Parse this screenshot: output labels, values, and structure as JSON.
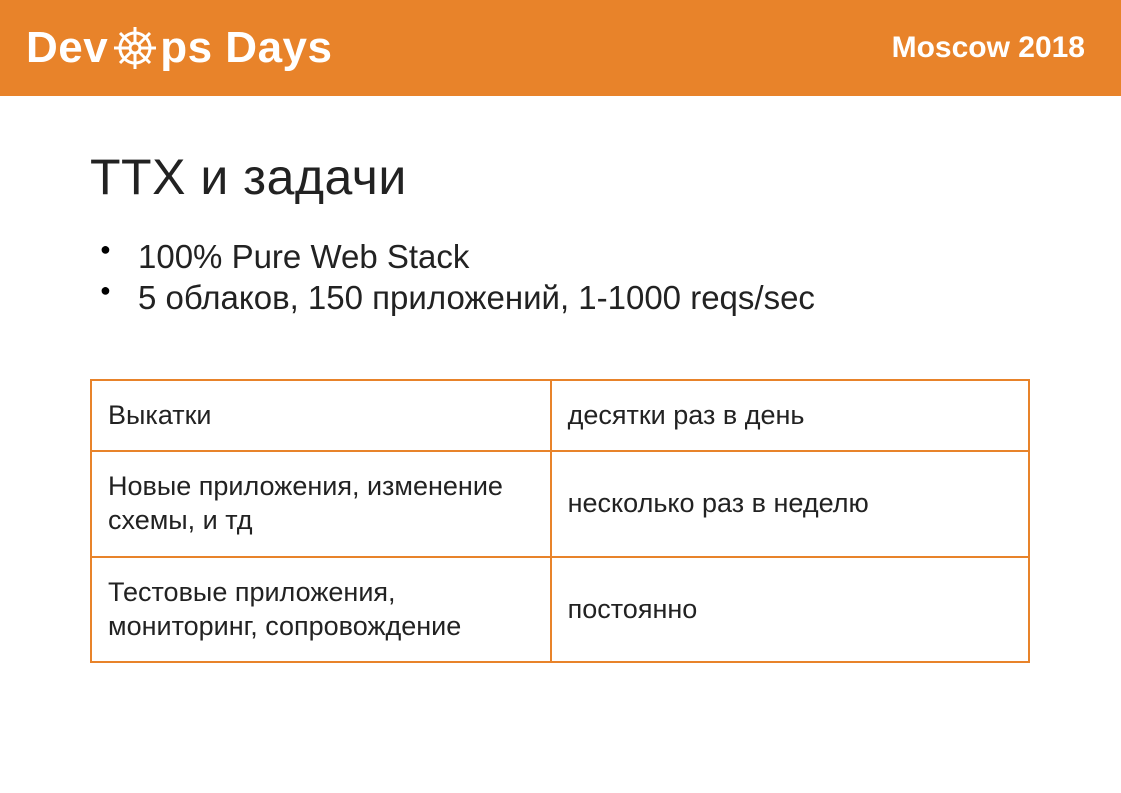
{
  "header": {
    "logo_prefix": "Dev",
    "logo_suffix": "ps Days",
    "event": "Moscow 2018"
  },
  "slide": {
    "title": "ТТХ и задачи",
    "bullets": [
      "100% Pure Web Stack",
      "5 облаков, 150 приложений, 1-1000 reqs/sec"
    ],
    "table": [
      {
        "left": "Выкатки",
        "right": "десятки раз в день"
      },
      {
        "left": "Новые приложения, изменение схемы, и тд",
        "right": "несколько раз в неделю"
      },
      {
        "left": "Тестовые приложения, мониторинг, сопровождение",
        "right": "постоянно"
      }
    ]
  }
}
